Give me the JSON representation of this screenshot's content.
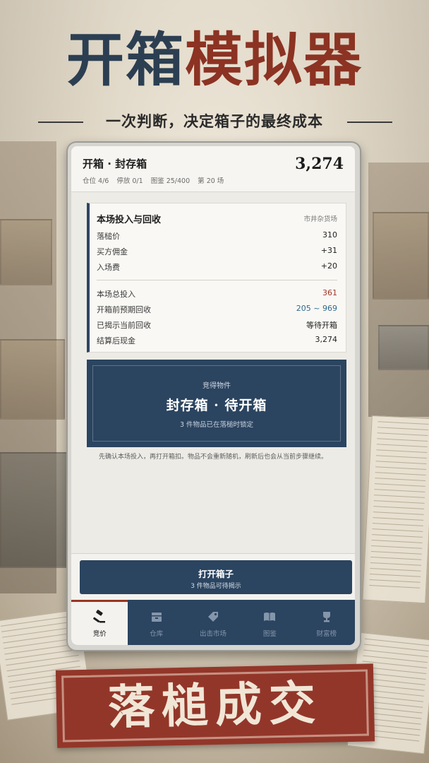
{
  "poster": {
    "title_left": "开箱",
    "title_right": "模拟器",
    "subtitle": "一次判断，决定箱子的最终成本",
    "stamp": "落槌成交",
    "colors": {
      "navy": "#2b4460",
      "rust": "#93362a",
      "paper": "#ecebe6"
    }
  },
  "header": {
    "title": "开箱 · 封存箱",
    "cash": "3,274",
    "meta": [
      "仓位 4/6",
      "停放 0/1",
      "图鉴 25/400",
      "第 20 场"
    ]
  },
  "summary": {
    "title": "本场投入与回收",
    "source": "市井杂货场",
    "rows": [
      {
        "label": "落槌价",
        "value": "310"
      },
      {
        "label": "买方佣金",
        "value": "+31"
      },
      {
        "label": "入场费",
        "value": "+20"
      }
    ],
    "totals": [
      {
        "label": "本场总投入",
        "value": "361",
        "color": "#a3362a"
      },
      {
        "label": "开箱前预期回收",
        "value": "205 ~ 969",
        "color": "#2f6a8f"
      },
      {
        "label": "已揭示当前回收",
        "value": "等待开箱",
        "color": "#222222"
      },
      {
        "label": "结算后现金",
        "value": "3,274",
        "color": "#222222"
      }
    ]
  },
  "lot": {
    "label": "竞得物件",
    "name": "封存箱 · 待开箱",
    "detail": "3 件物品已在落槌时锁定"
  },
  "note": "先确认本场投入，再打开箱扣。物品不会重新随机，刷新后也会从当前步骤继续。",
  "action": {
    "label": "打开箱子",
    "sublabel": "3 件物品可待揭示"
  },
  "tabs": [
    {
      "label": "竞价",
      "icon": "gavel-icon",
      "active": true
    },
    {
      "label": "仓库",
      "icon": "warehouse-box-icon",
      "active": false
    },
    {
      "label": "出击市场",
      "icon": "price-tag-icon",
      "active": false
    },
    {
      "label": "图鉴",
      "icon": "open-book-icon",
      "active": false
    },
    {
      "label": "财富榜",
      "icon": "trophy-icon",
      "active": false
    }
  ]
}
